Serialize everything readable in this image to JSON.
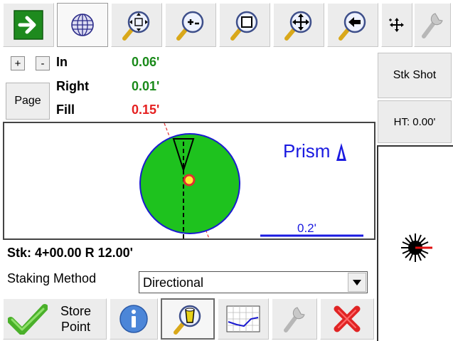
{
  "toolbar": {
    "buttons": [
      {
        "name": "next-arrow-icon"
      },
      {
        "name": "globe-icon"
      },
      {
        "name": "zoom-extents-icon"
      },
      {
        "name": "zoom-in-out-icon"
      },
      {
        "name": "zoom-window-icon"
      },
      {
        "name": "pan-icon"
      },
      {
        "name": "zoom-previous-icon"
      },
      {
        "name": "crosshair-icon"
      },
      {
        "name": "wrench-icon"
      }
    ]
  },
  "controls": {
    "plus_label": "+",
    "minus_label": "-",
    "page_label": "Page"
  },
  "deltas": {
    "in_label": "In",
    "in_value": "0.06'",
    "right_label": "Right",
    "right_value": "0.01'",
    "fill_label": "Fill",
    "fill_value": "0.15'",
    "positive_color": "#1a8a1a",
    "fill_color": "#e52020"
  },
  "plan_view": {
    "prism_label": "Prism",
    "scale_label": "0.2'",
    "target_color": "#1ec21e",
    "label_color": "#1a1ae0"
  },
  "side": {
    "stk_shot_label": "Stk Shot",
    "ht_label": "HT: 0.00'"
  },
  "station": {
    "label": "Stk: 4+00.00 R 12.00'"
  },
  "staking_method": {
    "label": "Staking Method",
    "value": "Directional"
  },
  "bottom": {
    "store_line1": "Store",
    "store_line2": "Point"
  }
}
